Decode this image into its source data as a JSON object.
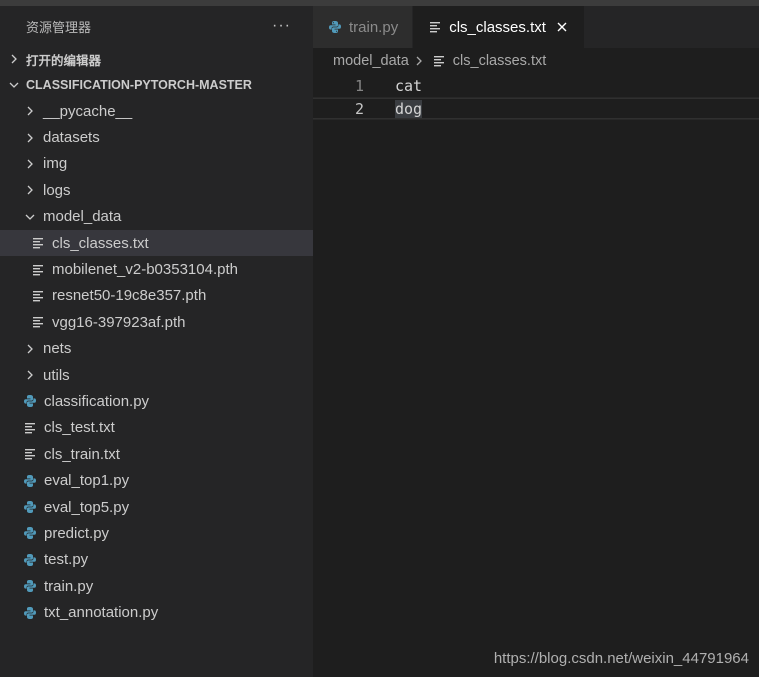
{
  "sidebar": {
    "title": "资源管理器",
    "more_label": "···",
    "open_editors_label": "打开的编辑器",
    "project_label": "CLASSIFICATION-PYTORCH-MASTER",
    "items": [
      {
        "label": "__pycache__",
        "type": "folder",
        "depth": 1,
        "expanded": false
      },
      {
        "label": "datasets",
        "type": "folder",
        "depth": 1,
        "expanded": false
      },
      {
        "label": "img",
        "type": "folder",
        "depth": 1,
        "expanded": false
      },
      {
        "label": "logs",
        "type": "folder",
        "depth": 1,
        "expanded": false
      },
      {
        "label": "model_data",
        "type": "folder",
        "depth": 1,
        "expanded": true
      },
      {
        "label": "cls_classes.txt",
        "type": "text",
        "depth": 2,
        "selected": true
      },
      {
        "label": "mobilenet_v2-b0353104.pth",
        "type": "text",
        "depth": 2
      },
      {
        "label": "resnet50-19c8e357.pth",
        "type": "text",
        "depth": 2
      },
      {
        "label": "vgg16-397923af.pth",
        "type": "text",
        "depth": 2
      },
      {
        "label": "nets",
        "type": "folder",
        "depth": 1,
        "expanded": false
      },
      {
        "label": "utils",
        "type": "folder",
        "depth": 1,
        "expanded": false
      },
      {
        "label": "classification.py",
        "type": "python",
        "depth": 1
      },
      {
        "label": "cls_test.txt",
        "type": "text",
        "depth": 1
      },
      {
        "label": "cls_train.txt",
        "type": "text",
        "depth": 1
      },
      {
        "label": "eval_top1.py",
        "type": "python",
        "depth": 1
      },
      {
        "label": "eval_top5.py",
        "type": "python",
        "depth": 1
      },
      {
        "label": "predict.py",
        "type": "python",
        "depth": 1
      },
      {
        "label": "test.py",
        "type": "python",
        "depth": 1
      },
      {
        "label": "train.py",
        "type": "python",
        "depth": 1
      },
      {
        "label": "txt_annotation.py",
        "type": "python",
        "depth": 1
      }
    ]
  },
  "tabs": [
    {
      "label": "train.py",
      "icon": "python-icon",
      "active": false
    },
    {
      "label": "cls_classes.txt",
      "icon": "text-file-icon",
      "active": true
    }
  ],
  "breadcrumb": {
    "folder": "model_data",
    "file": "cls_classes.txt"
  },
  "editor": {
    "lines": [
      {
        "num": "1",
        "text": "cat"
      },
      {
        "num": "2",
        "text": "dog"
      }
    ]
  },
  "watermark": "https://blog.csdn.net/weixin_44791964",
  "colors": {
    "python_icon": "#519aba",
    "sidebar_bg": "#252526",
    "editor_bg": "#1e1e1e",
    "selected_row": "#37373d"
  }
}
